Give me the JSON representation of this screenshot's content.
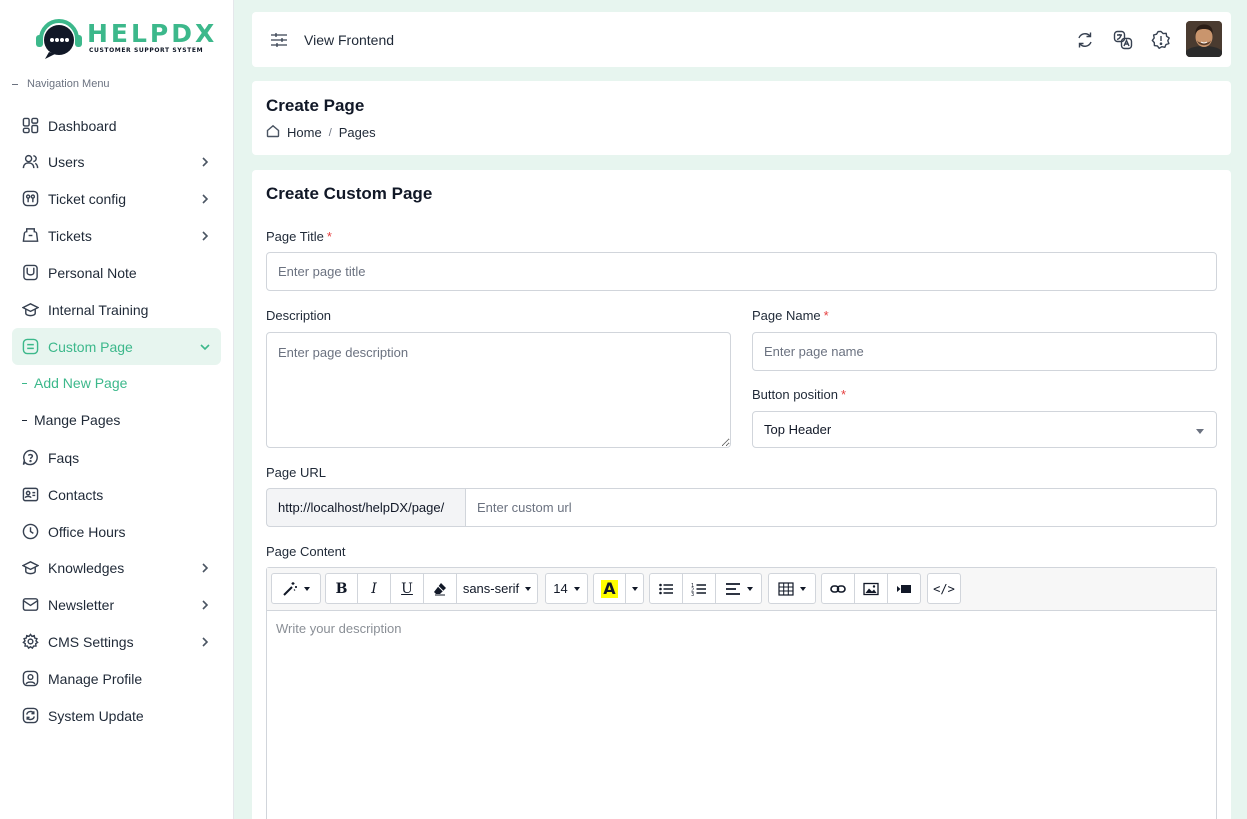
{
  "brand": {
    "name": "HELPDX",
    "tagline": "CUSTOMER SUPPORT SYSTEM",
    "accent": "#3cb88b"
  },
  "sidebar": {
    "heading": "Navigation Menu",
    "items": [
      {
        "label": "Dashboard",
        "icon": "dashboard-icon"
      },
      {
        "label": "Users",
        "icon": "users-icon"
      },
      {
        "label": "Ticket config",
        "icon": "ticket-config-icon"
      },
      {
        "label": "Tickets",
        "icon": "tickets-icon"
      },
      {
        "label": "Personal Note",
        "icon": "note-icon"
      },
      {
        "label": "Internal Training",
        "icon": "graduation-cap-icon"
      },
      {
        "label": "Custom Page",
        "icon": "page-icon"
      },
      {
        "label": "Faqs",
        "icon": "question-bubble-icon"
      },
      {
        "label": "Contacts",
        "icon": "contact-card-icon"
      },
      {
        "label": "Office Hours",
        "icon": "clock-icon"
      },
      {
        "label": "Knowledges",
        "icon": "knowledge-icon"
      },
      {
        "label": "Newsletter",
        "icon": "newsletter-icon"
      },
      {
        "label": "CMS Settings",
        "icon": "gear-icon"
      },
      {
        "label": "Manage Profile",
        "icon": "profile-icon"
      },
      {
        "label": "System Update",
        "icon": "update-icon"
      }
    ],
    "subitems": [
      {
        "label": "Add New Page"
      },
      {
        "label": "Mange Pages"
      }
    ]
  },
  "header": {
    "view_frontend": "View Frontend",
    "icons": [
      "sync-icon",
      "translate-icon",
      "alert-icon"
    ]
  },
  "page": {
    "title": "Create Page",
    "breadcrumb": [
      "Home",
      "Pages"
    ]
  },
  "form": {
    "title": "Create Custom Page",
    "page_title_label": "Page Title",
    "page_title_placeholder": "Enter page title",
    "description_label": "Description",
    "description_placeholder": "Enter page description",
    "page_name_label": "Page Name",
    "page_name_placeholder": "Enter page name",
    "button_position_label": "Button position",
    "button_position_value": "Top Header",
    "page_url_label": "Page URL",
    "page_url_prefix": "http://localhost/helpDX/page/",
    "page_url_placeholder": "Enter custom url",
    "page_content_label": "Page Content",
    "required_mark": "*"
  },
  "editor": {
    "font_family": "sans-serif",
    "font_size": "14",
    "bold": "B",
    "italic": "I",
    "underline": "U",
    "highlight": "A",
    "code": "</>",
    "placeholder": "Write your description"
  }
}
